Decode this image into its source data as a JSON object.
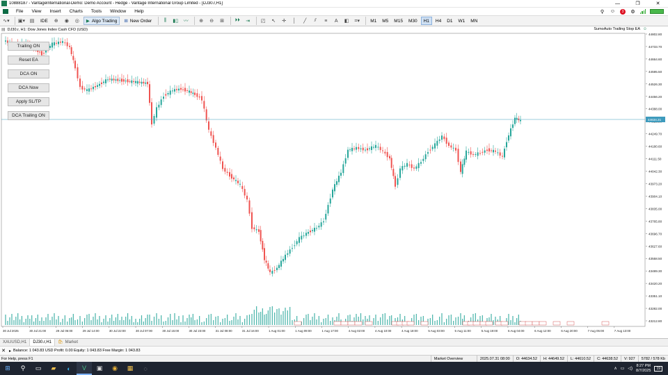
{
  "window": {
    "title": "10888187 - VantageInternational-Demo: Demo Account - Hedge - Vantage International Group Limited - [DJ30.r,H1]",
    "controls": [
      "—",
      "❐",
      "✕"
    ]
  },
  "menu": {
    "items": [
      "File",
      "View",
      "Insert",
      "Charts",
      "Tools",
      "Window",
      "Help"
    ],
    "notification_count": "3"
  },
  "toolbar": {
    "ide_label": "IDE",
    "algo_label": "Algo Trading",
    "new_order_label": "New Order",
    "timeframes": [
      "M1",
      "M5",
      "M15",
      "M30",
      "H1",
      "H4",
      "D1",
      "W1",
      "MN"
    ],
    "active_timeframe": "H1"
  },
  "chart": {
    "symbol_label": "DJ30.r, H1:  Dow Jones Index Cash CFD (USD)",
    "ea_name": "SumoAuto Trailing Stop EA",
    "current_price": "44634.31",
    "colors": {
      "bull": "#26a69a",
      "bear": "#ef5350",
      "grid": "#e0e0e0",
      "hline": "#3e9bbd",
      "volume": "#26a69a",
      "price_label_bg": "#3e9bbd"
    },
    "price_labels": [
      "44802.80",
      "44733.70",
      "44664.60",
      "44595.50",
      "44526.30",
      "44456.20",
      "44388.00",
      "44318.90",
      "44249.70",
      "44180.60",
      "44111.50",
      "44042.30",
      "43973.20",
      "43904.10",
      "43835.00",
      "43765.80",
      "43696.70",
      "43627.60",
      "43558.50",
      "43489.30",
      "43420.20",
      "43351.10",
      "43282.00",
      "43212.80"
    ],
    "time_labels": [
      "30 Jul 2025",
      "30 Jul 21:00",
      "29 Jul 06:00",
      "29 Jul 14:00",
      "30 Jul 22:00",
      "30 Jul 07:00",
      "30 Jul 15:00",
      "30 Jul 23:00",
      "31 Jul 08:00",
      "31 Jul 16:00",
      "1 Aug 01:00",
      "1 Aug 09:00",
      "1 Aug 17:00",
      "4 Aug 02:00",
      "4 Aug 10:00",
      "4 Aug 18:00",
      "5 Aug 03:00",
      "5 Aug 11:00",
      "5 Aug 19:00",
      "6 Aug 04:00",
      "6 Aug 12:00",
      "6 Aug 20:00",
      "7 Aug 05:00",
      "7 Aug 13:00"
    ]
  },
  "ea_buttons": [
    "Trailing ON",
    "Reset EA",
    "DCA ON",
    "DCA Now",
    "Apply SL/TP",
    "DCA Trailing ON"
  ],
  "chart_tabs": [
    "XAUUSD,H1",
    "DJ30.r,H1",
    "Market"
  ],
  "toolbox": {
    "balance_line": "Balance: 1 043.83 USD  Profit: 0.00  Equity: 1 043.83  Free Margin: 1 043.83"
  },
  "status": {
    "help": "For Help, press F1",
    "market_overview": "Market Overview",
    "datetime": "2025.07.31 08:00",
    "open": "O: 44634.52",
    "high": "H: 44649.52",
    "low": "L: 44610.52",
    "close": "C: 44638.52",
    "volume": "V: 927",
    "traffic": "5782 / 578 Kb"
  },
  "taskbar": {
    "time": "8:27 PM",
    "date": "8/7/2025",
    "notification": "19"
  }
}
